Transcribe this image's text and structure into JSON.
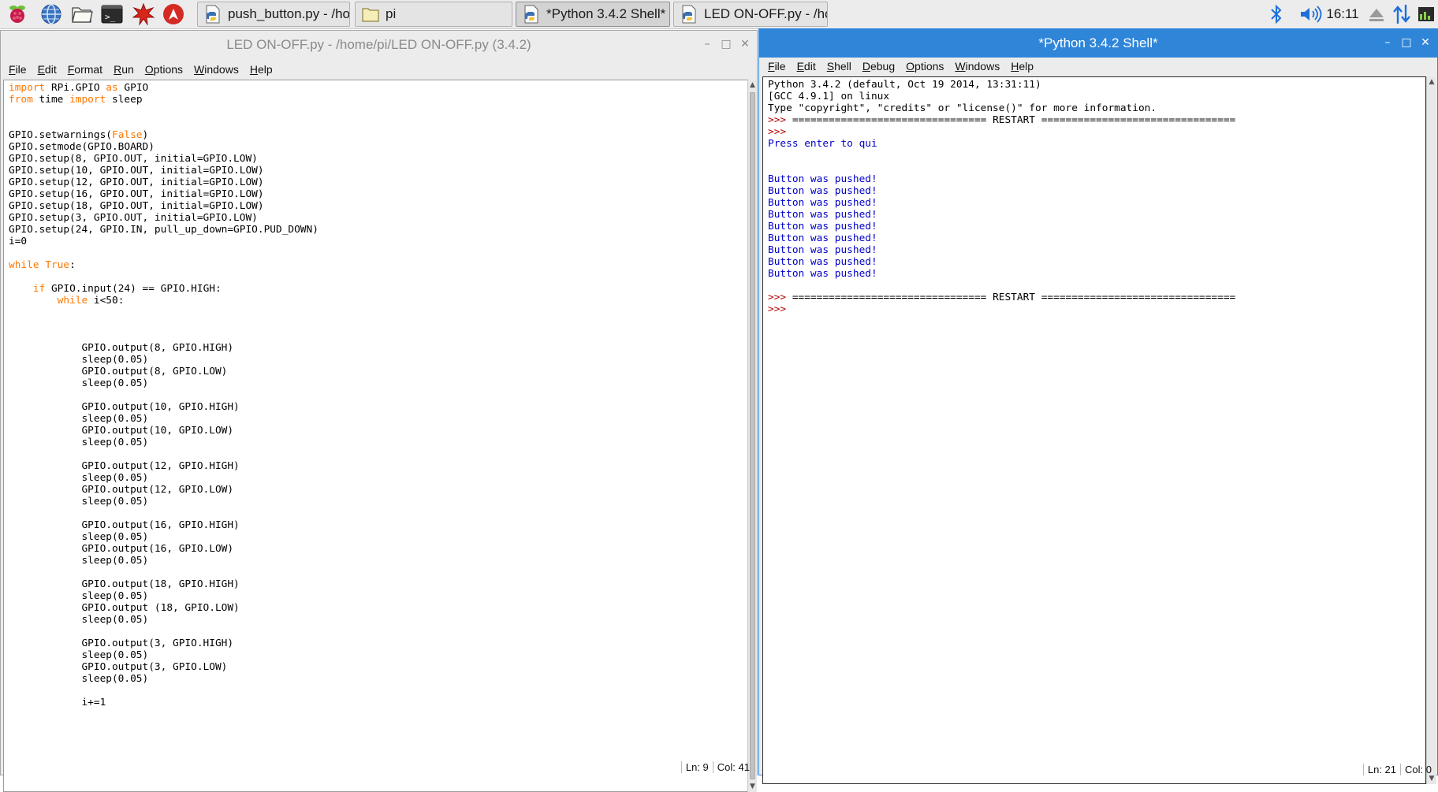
{
  "taskbar": {
    "launchers": [
      {
        "name": "raspberry-menu-icon"
      },
      {
        "name": "web-browser-icon"
      },
      {
        "name": "file-manager-icon"
      },
      {
        "name": "terminal-icon"
      },
      {
        "name": "math-kernel-icon"
      },
      {
        "name": "wolfram-icon"
      }
    ],
    "tasks": [
      {
        "label": "push_button.py - /ho...",
        "icon": "python-file-icon",
        "active": false
      },
      {
        "label": "pi",
        "icon": "folder-icon",
        "active": false
      },
      {
        "label": "*Python 3.4.2 Shell*",
        "icon": "python-file-icon",
        "active": true
      },
      {
        "label": "LED ON-OFF.py - /ho...",
        "icon": "python-file-icon",
        "active": false
      }
    ],
    "clock": "16:11",
    "tray_icons": [
      "bluetooth-icon",
      "volume-icon",
      "eject-icon",
      "network-arrows-icon",
      "cpu-monitor-icon"
    ]
  },
  "editor": {
    "title": "LED ON-OFF.py - /home/pi/LED ON-OFF.py (3.4.2)",
    "menu": [
      "File",
      "Edit",
      "Format",
      "Run",
      "Options",
      "Windows",
      "Help"
    ],
    "lines": [
      "import RPi.GPIO as GPIO",
      "from time import sleep",
      "",
      "",
      "GPIO.setwarnings(False)",
      "GPIO.setmode(GPIO.BOARD)",
      "GPIO.setup(8, GPIO.OUT, initial=GPIO.LOW)",
      "GPIO.setup(10, GPIO.OUT, initial=GPIO.LOW)",
      "GPIO.setup(12, GPIO.OUT, initial=GPIO.LOW)",
      "GPIO.setup(16, GPIO.OUT, initial=GPIO.LOW)",
      "GPIO.setup(18, GPIO.OUT, initial=GPIO.LOW)",
      "GPIO.setup(3, GPIO.OUT, initial=GPIO.LOW)",
      "GPIO.setup(24, GPIO.IN, pull_up_down=GPIO.PUD_DOWN)",
      "i=0",
      "",
      "while True:",
      "",
      "    if GPIO.input(24) == GPIO.HIGH:",
      "        while i<50:",
      "",
      "",
      "",
      "            GPIO.output(8, GPIO.HIGH)",
      "            sleep(0.05)",
      "            GPIO.output(8, GPIO.LOW)",
      "            sleep(0.05)",
      "",
      "            GPIO.output(10, GPIO.HIGH)",
      "            sleep(0.05)",
      "            GPIO.output(10, GPIO.LOW)",
      "            sleep(0.05)",
      "",
      "            GPIO.output(12, GPIO.HIGH)",
      "            sleep(0.05)",
      "            GPIO.output(12, GPIO.LOW)",
      "            sleep(0.05)",
      "",
      "            GPIO.output(16, GPIO.HIGH)",
      "            sleep(0.05)",
      "            GPIO.output(16, GPIO.LOW)",
      "            sleep(0.05)",
      "",
      "            GPIO.output(18, GPIO.HIGH)",
      "            sleep(0.05)",
      "            GPIO.output (18, GPIO.LOW)",
      "            sleep(0.05)",
      "",
      "            GPIO.output(3, GPIO.HIGH)",
      "            sleep(0.05)",
      "            GPIO.output(3, GPIO.LOW)",
      "            sleep(0.05)",
      "",
      "            i+=1"
    ],
    "keywords": [
      "import",
      "from",
      "as",
      "False",
      "True",
      "while",
      "if"
    ],
    "status": {
      "line": "Ln: 9",
      "col": "Col: 41"
    }
  },
  "shell": {
    "title": "*Python 3.4.2 Shell*",
    "menu": [
      "File",
      "Edit",
      "Shell",
      "Debug",
      "Options",
      "Windows",
      "Help"
    ],
    "lines": [
      {
        "t": "Python 3.4.2 (default, Oct 19 2014, 13:31:11)",
        "k": "std"
      },
      {
        "t": "[GCC 4.9.1] on linux",
        "k": "std"
      },
      {
        "t": "Type \"copyright\", \"credits\" or \"license()\" for more information.",
        "k": "std"
      },
      {
        "t": ">>> ================================ RESTART ================================",
        "k": "restart"
      },
      {
        "t": ">>> ",
        "k": "prompt"
      },
      {
        "t": "Press enter to qui",
        "k": "out"
      },
      {
        "t": "",
        "k": "std"
      },
      {
        "t": "",
        "k": "std"
      },
      {
        "t": "Button was pushed!",
        "k": "out"
      },
      {
        "t": "Button was pushed!",
        "k": "out"
      },
      {
        "t": "Button was pushed!",
        "k": "out"
      },
      {
        "t": "Button was pushed!",
        "k": "out"
      },
      {
        "t": "Button was pushed!",
        "k": "out"
      },
      {
        "t": "Button was pushed!",
        "k": "out"
      },
      {
        "t": "Button was pushed!",
        "k": "out"
      },
      {
        "t": "Button was pushed!",
        "k": "out"
      },
      {
        "t": "Button was pushed!",
        "k": "out"
      },
      {
        "t": "",
        "k": "std"
      },
      {
        "t": ">>> ================================ RESTART ================================",
        "k": "restart"
      },
      {
        "t": ">>> ",
        "k": "prompt"
      }
    ],
    "status": {
      "line": "Ln: 21",
      "col": "Col: 0"
    }
  },
  "colors": {
    "keyword": "#ff7700",
    "output": "#0000c8",
    "prompt": "#b00000",
    "active_titlebar": "#2f86d9",
    "inactive_titlebar": "#ececec"
  }
}
